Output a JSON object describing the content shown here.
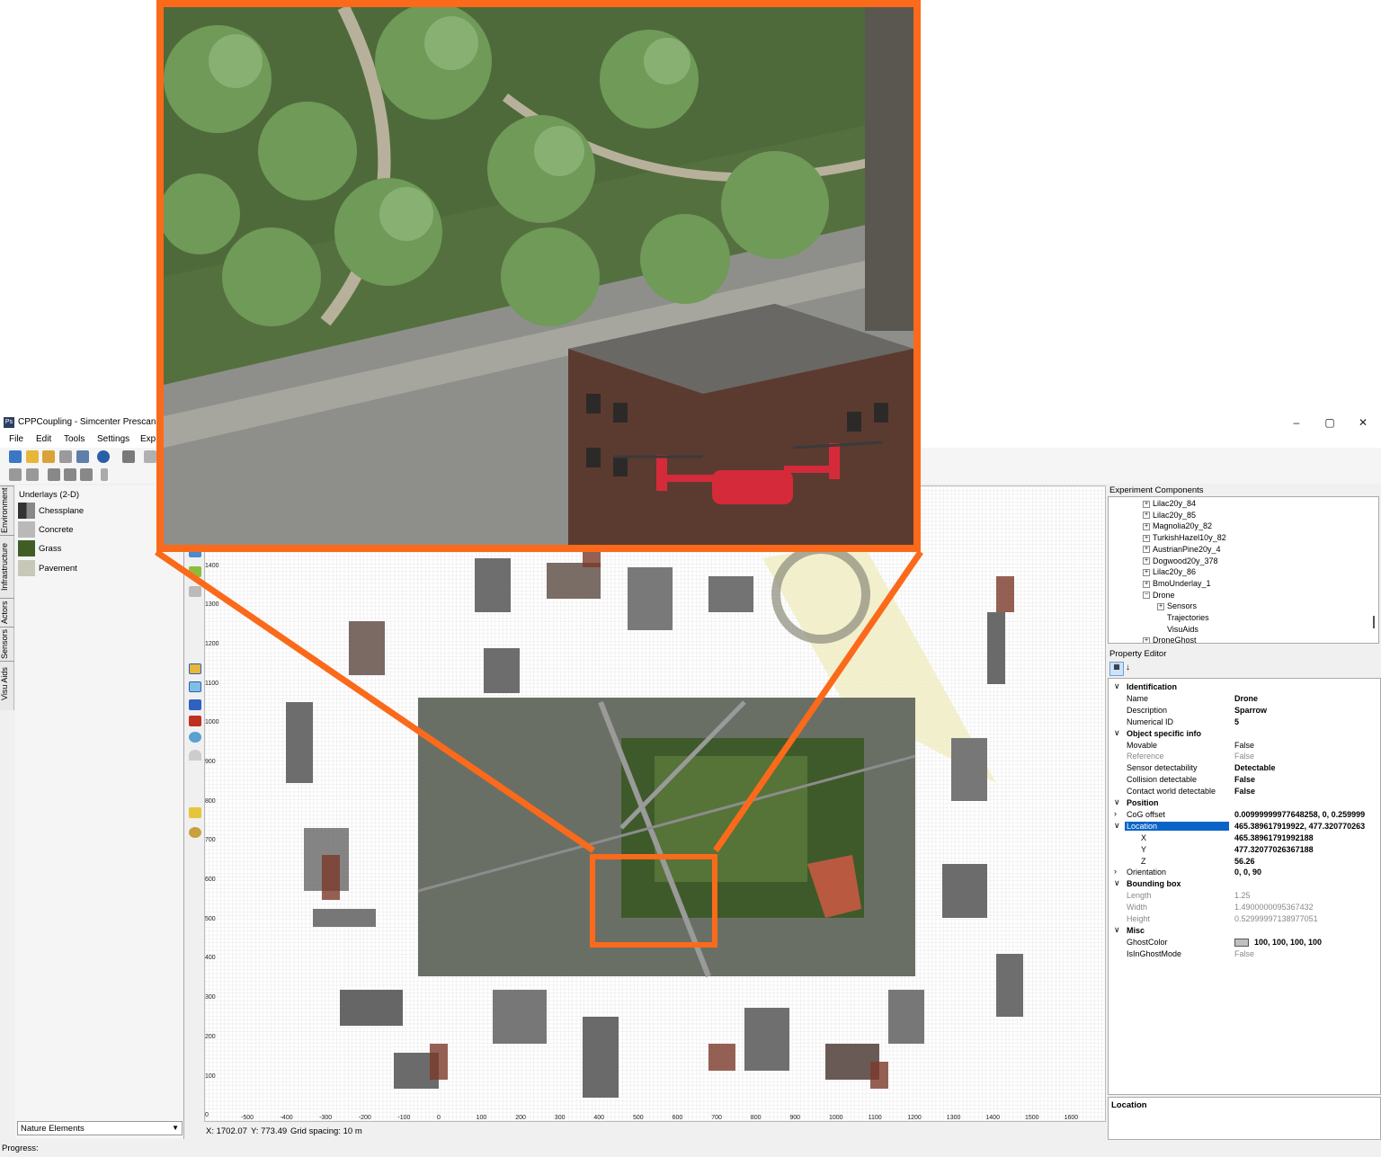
{
  "window": {
    "title": "CPPCoupling - Simcenter Prescan Ex",
    "app_icon_text": "Ps",
    "controls": {
      "minimize": "–",
      "maximize": "▢",
      "close": "✕"
    }
  },
  "menu": [
    "File",
    "Edit",
    "Tools",
    "Settings",
    "Exp"
  ],
  "side_tabs": [
    "Environment",
    "Infrastructure",
    "Actors",
    "Sensors",
    "Visu Aids"
  ],
  "underlays": {
    "header": "Underlays (2-D)",
    "items": [
      {
        "label": "Chessplane",
        "color": "#4a4a4a"
      },
      {
        "label": "Concrete",
        "color": "#b9b9b9"
      },
      {
        "label": "Grass",
        "color": "#3f5e26"
      },
      {
        "label": "Pavement",
        "color": "#c8c8b8"
      }
    ],
    "category_select": "Nature Elements"
  },
  "y_axis_labels": [
    "1400",
    "1300",
    "1200",
    "1100",
    "1000",
    "900",
    "800",
    "700",
    "600",
    "500",
    "400",
    "300",
    "200",
    "100",
    "0"
  ],
  "x_axis_labels": [
    "-500",
    "-400",
    "-300",
    "-200",
    "-100",
    "0",
    "100",
    "200",
    "300",
    "400",
    "500",
    "600",
    "700",
    "800",
    "900",
    "1000",
    "1100",
    "1200",
    "1300",
    "1400",
    "1500",
    "1600"
  ],
  "status": {
    "x": "X: 1702.07",
    "y": "Y: 773.49",
    "grid": "Grid spacing: 10 m"
  },
  "progress_label": "Progress:",
  "experiment_components": {
    "header": "Experiment Components",
    "tree": [
      {
        "label": "Lilac20y_84",
        "level": 2,
        "expander": "+"
      },
      {
        "label": "Lilac20y_85",
        "level": 2,
        "expander": "+"
      },
      {
        "label": "Magnolia20y_82",
        "level": 2,
        "expander": "+"
      },
      {
        "label": "TurkishHazel10y_82",
        "level": 2,
        "expander": "+"
      },
      {
        "label": "AustrianPine20y_4",
        "level": 2,
        "expander": "+"
      },
      {
        "label": "Dogwood20y_378",
        "level": 2,
        "expander": "+"
      },
      {
        "label": "Lilac20y_86",
        "level": 2,
        "expander": "+"
      },
      {
        "label": "BmoUnderlay_1",
        "level": 2,
        "expander": "+"
      },
      {
        "label": "Drone",
        "level": 2,
        "expander": "−"
      },
      {
        "label": "Sensors",
        "level": 3,
        "expander": "+"
      },
      {
        "label": "Trajectories",
        "level": 3,
        "expander": ""
      },
      {
        "label": "VisuAids",
        "level": 3,
        "expander": ""
      },
      {
        "label": "DroneGhost",
        "level": 2,
        "expander": "+"
      }
    ]
  },
  "property_editor": {
    "header": "Property Editor",
    "rows": [
      {
        "type": "cat",
        "key": "Identification",
        "chev": "∨"
      },
      {
        "key": "Name",
        "value": "Drone",
        "vstyle": "bold"
      },
      {
        "key": "Description",
        "value": "Sparrow",
        "vstyle": "bold"
      },
      {
        "key": "Numerical ID",
        "value": "5",
        "vstyle": "bold"
      },
      {
        "type": "cat",
        "key": "Object specific info",
        "chev": "∨"
      },
      {
        "key": "Movable",
        "value": "False"
      },
      {
        "key": "Reference",
        "value": "False",
        "kstyle": "grey",
        "vstyle": "grey"
      },
      {
        "key": "Sensor detectability",
        "value": "Detectable",
        "vstyle": "bold"
      },
      {
        "key": "Collision detectable",
        "value": "False",
        "vstyle": "bold"
      },
      {
        "key": "Contact world detectable",
        "value": "False",
        "vstyle": "bold"
      },
      {
        "type": "cat",
        "key": "Position",
        "chev": "∨"
      },
      {
        "key": "CoG offset",
        "value": "0.00999999977648258, 0, 0.259999",
        "vstyle": "bold",
        "chev": "›"
      },
      {
        "key": "Location",
        "value": "465.389617919922, 477.320770263",
        "vstyle": "bold",
        "chev": "∨",
        "selected": true
      },
      {
        "key": "X",
        "value": "465.38961791992188",
        "vstyle": "bold",
        "indent": true
      },
      {
        "key": "Y",
        "value": "477.32077026367188",
        "vstyle": "bold",
        "indent": true
      },
      {
        "key": "Z",
        "value": "56.26",
        "vstyle": "bold",
        "indent": true
      },
      {
        "key": "Orientation",
        "value": "0, 0, 90",
        "vstyle": "bold",
        "chev": "›"
      },
      {
        "type": "cat",
        "key": "Bounding box",
        "chev": "∨"
      },
      {
        "key": "Length",
        "value": "1.25",
        "kstyle": "grey",
        "vstyle": "grey"
      },
      {
        "key": "Width",
        "value": "1.4900000095367432",
        "kstyle": "grey",
        "vstyle": "grey"
      },
      {
        "key": "Height",
        "value": "0.52999997138977051",
        "kstyle": "grey",
        "vstyle": "grey"
      },
      {
        "type": "cat",
        "key": "Misc",
        "chev": "∨"
      },
      {
        "key": "GhostColor",
        "value": "100, 100, 100, 100",
        "vstyle": "bold",
        "swatch": "#c0c0c0"
      },
      {
        "key": "IsInGhostMode",
        "value": "False",
        "vstyle": "grey"
      }
    ],
    "description_title": "Location"
  },
  "colors": {
    "highlight": "#fb6a1a",
    "selection": "#0a64c8"
  }
}
